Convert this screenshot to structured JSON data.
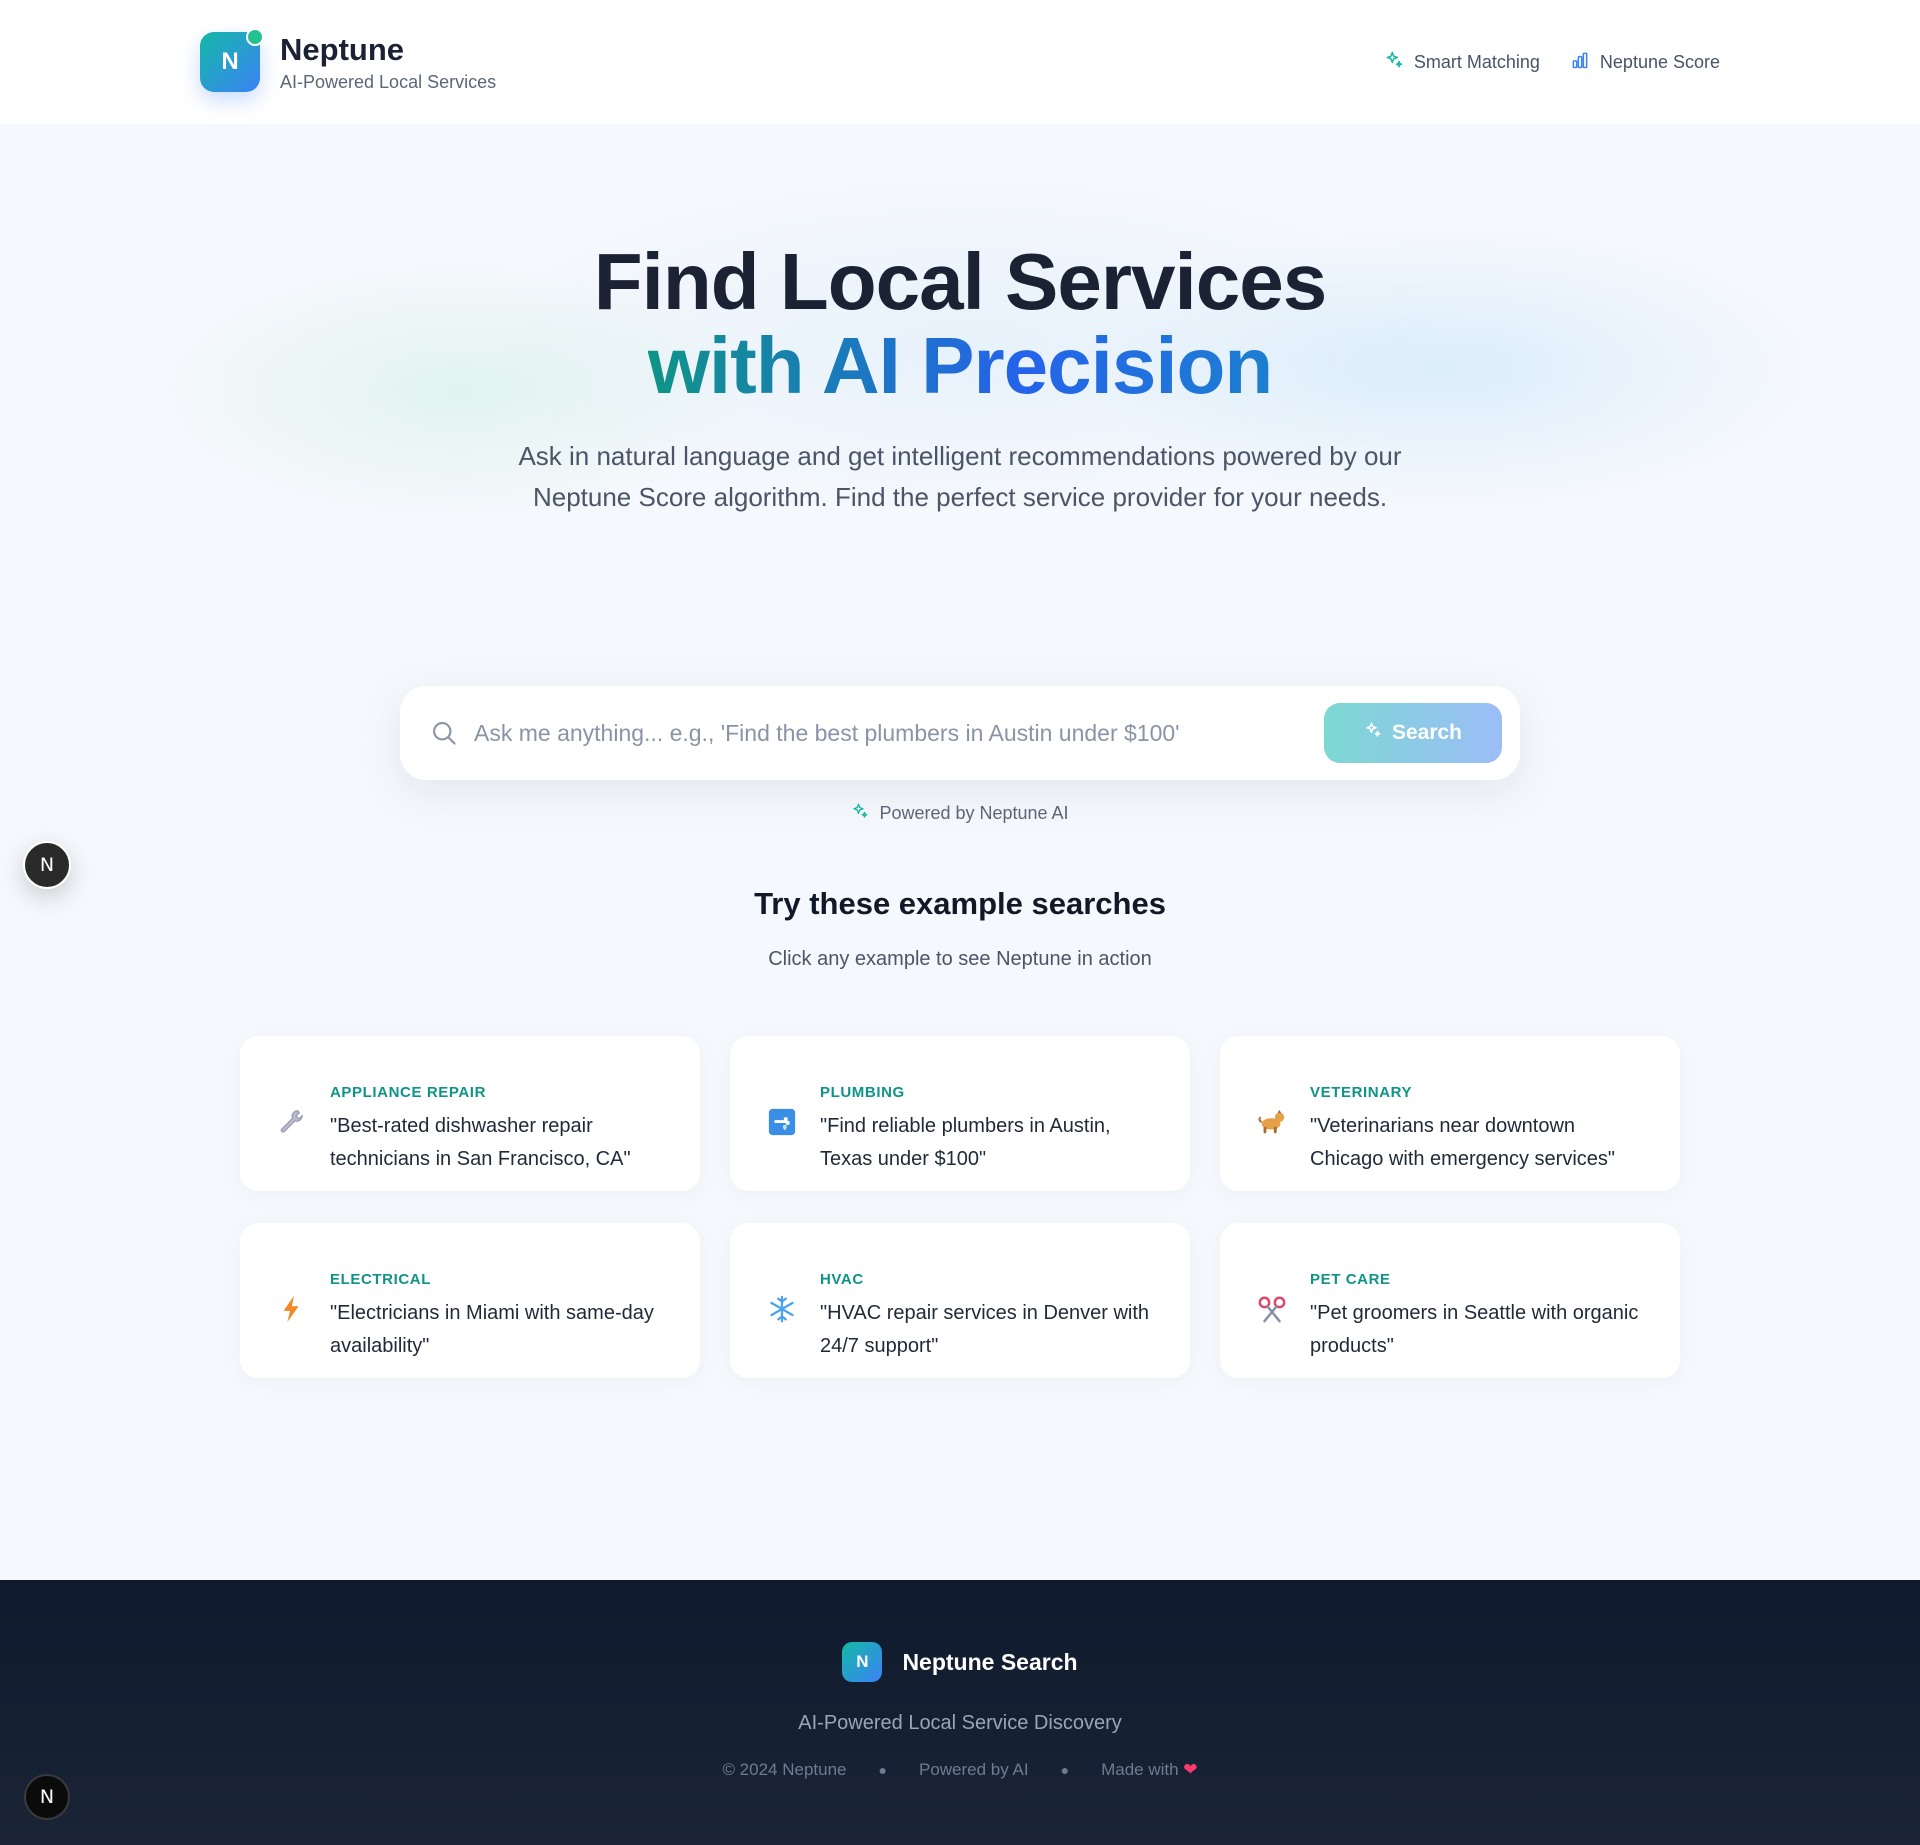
{
  "header": {
    "logo_letter": "N",
    "brand_name": "Neptune",
    "brand_tagline": "AI-Powered Local Services",
    "nav": [
      {
        "label": "Smart Matching",
        "icon": "sparkles-icon"
      },
      {
        "label": "Neptune Score",
        "icon": "bar-chart-icon"
      }
    ]
  },
  "hero": {
    "title_line1": "Find Local Services",
    "title_line2": "with AI Precision",
    "subtitle": "Ask in natural language and get intelligent recommendations powered by our Neptune Score algorithm. Find the perfect service provider for your needs."
  },
  "search": {
    "placeholder": "Ask me anything... e.g., 'Find the best plumbers in Austin under $100'",
    "value": "",
    "button_label": "Search",
    "powered_by": "Powered by Neptune AI"
  },
  "examples": {
    "title": "Try these example searches",
    "subtitle": "Click any example to see Neptune in action",
    "items": [
      {
        "category": "APPLIANCE REPAIR",
        "query": "\"Best-rated dishwasher repair technicians in San Francisco, CA\"",
        "icon": "wrench-icon"
      },
      {
        "category": "PLUMBING",
        "query": "\"Find reliable plumbers in Austin, Texas under $100\"",
        "icon": "faucet-icon"
      },
      {
        "category": "VETERINARY",
        "query": "\"Veterinarians near downtown Chicago with emergency services\"",
        "icon": "dog-icon"
      },
      {
        "category": "ELECTRICAL",
        "query": "\"Electricians in Miami with same-day availability\"",
        "icon": "lightning-icon"
      },
      {
        "category": "HVAC",
        "query": "\"HVAC repair services in Denver with 24/7 support\"",
        "icon": "snowflake-icon"
      },
      {
        "category": "PET CARE",
        "query": "\"Pet groomers in Seattle with organic products\"",
        "icon": "scissors-icon"
      }
    ]
  },
  "floating": {
    "letter": "N"
  },
  "footer": {
    "logo_letter": "N",
    "brand_name": "Neptune Search",
    "tagline": "AI-Powered Local Service Discovery",
    "copyright": "© 2024 Neptune",
    "powered": "Powered by AI",
    "made_with": "Made with",
    "heart": "❤"
  },
  "colors": {
    "accent_teal": "#0f9488",
    "accent_blue": "#2563eb",
    "footer_bg": "#101a2e",
    "heart": "#ff3b6b"
  }
}
